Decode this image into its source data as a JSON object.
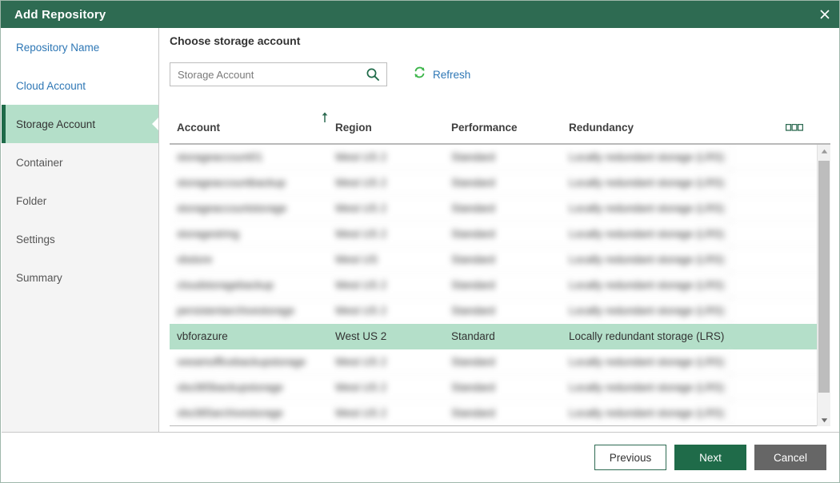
{
  "window": {
    "title": "Add Repository",
    "close_icon": "close-icon"
  },
  "sidebar": {
    "items": [
      {
        "label": "Repository Name",
        "state": "link"
      },
      {
        "label": "Cloud Account",
        "state": "link"
      },
      {
        "label": "Storage Account",
        "state": "active"
      },
      {
        "label": "Container",
        "state": "pending"
      },
      {
        "label": "Folder",
        "state": "pending"
      },
      {
        "label": "Settings",
        "state": "pending"
      },
      {
        "label": "Summary",
        "state": "pending"
      }
    ]
  },
  "main": {
    "title": "Choose storage account",
    "search": {
      "placeholder": "Storage Account",
      "value": "",
      "icon": "search-icon"
    },
    "refresh": {
      "label": "Refresh",
      "icon": "refresh-icon"
    },
    "table": {
      "columns": [
        "Account",
        "Region",
        "Performance",
        "Redundancy"
      ],
      "sort": {
        "column": "Account",
        "direction": "ascending",
        "icon": "sort-ascending-icon"
      },
      "column_options_icon": "column-options-icon",
      "rows": [
        {
          "account": "storageaccount01",
          "region": "West US 2",
          "performance": "Standard",
          "redundancy": "Locally redundant storage (LRS)",
          "redacted": true,
          "selected": false
        },
        {
          "account": "storageaccountbackup",
          "region": "West US 2",
          "performance": "Standard",
          "redundancy": "Locally redundant storage (LRS)",
          "redacted": true,
          "selected": false
        },
        {
          "account": "storageaccountstorage",
          "region": "West US 2",
          "performance": "Standard",
          "redundancy": "Locally redundant storage (LRS)",
          "redacted": true,
          "selected": false
        },
        {
          "account": "storagestring",
          "region": "West US 2",
          "performance": "Standard",
          "redundancy": "Locally redundant storage (LRS)",
          "redacted": true,
          "selected": false
        },
        {
          "account": "vbstore",
          "region": "West US",
          "performance": "Standard",
          "redundancy": "Locally redundant storage (LRS)",
          "redacted": true,
          "selected": false
        },
        {
          "account": "cloudstoragebackup",
          "region": "West US 2",
          "performance": "Standard",
          "redundancy": "Locally redundant storage (LRS)",
          "redacted": true,
          "selected": false
        },
        {
          "account": "persistentarchivestorage",
          "region": "West US 2",
          "performance": "Standard",
          "redundancy": "Locally redundant storage (LRS)",
          "redacted": true,
          "selected": false
        },
        {
          "account": "vbforazure",
          "region": "West US 2",
          "performance": "Standard",
          "redundancy": "Locally redundant storage (LRS)",
          "redacted": false,
          "selected": true
        },
        {
          "account": "veeamofficebackupstorage",
          "region": "West US 2",
          "performance": "Standard",
          "redundancy": "Locally redundant storage (LRS)",
          "redacted": true,
          "selected": false
        },
        {
          "account": "vbo365backupstorage",
          "region": "West US 2",
          "performance": "Standard",
          "redundancy": "Locally redundant storage (LRS)",
          "redacted": true,
          "selected": false
        },
        {
          "account": "vbo365archivestorage",
          "region": "West US 2",
          "performance": "Standard",
          "redundancy": "Locally redundant storage (LRS)",
          "redacted": true,
          "selected": false
        }
      ]
    },
    "scrollbar": {
      "up_icon": "scroll-up-icon",
      "down_icon": "scroll-down-icon"
    }
  },
  "footer": {
    "previous_label": "Previous",
    "next_label": "Next",
    "cancel_label": "Cancel"
  },
  "colors": {
    "title_bar": "#2e6b52",
    "accent_green": "#1f6b49",
    "selection_green": "#b4dfc9",
    "link_blue": "#2e77b5",
    "refresh_green": "#3cb54a",
    "cancel_gray": "#666666"
  }
}
